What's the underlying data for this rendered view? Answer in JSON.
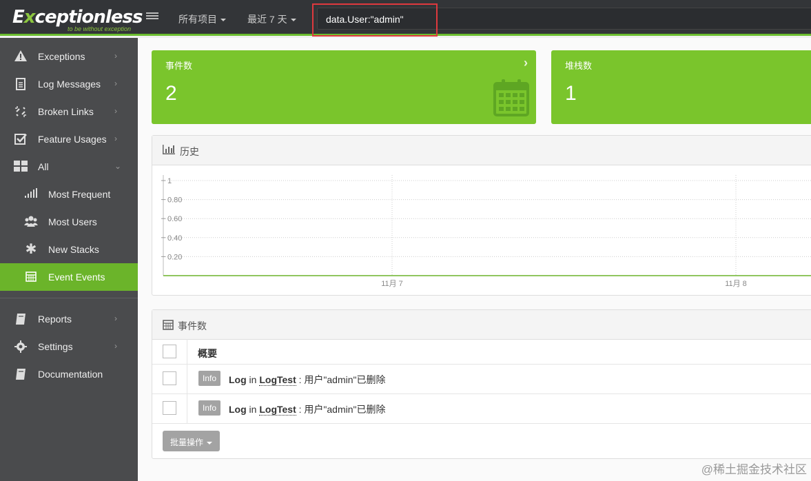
{
  "header": {
    "logo_prefix": "E",
    "logo_x": "x",
    "logo_rest": "ceptionless",
    "logo_tagline": "to be without exception",
    "project_dropdown": "所有项目",
    "time_dropdown": "最近 7 天",
    "search_value": "data.User:\"admin\""
  },
  "sidebar": {
    "items": [
      {
        "label": "Exceptions",
        "icon": "warning-icon"
      },
      {
        "label": "Log Messages",
        "icon": "file-text-icon"
      },
      {
        "label": "Broken Links",
        "icon": "unlink-icon"
      },
      {
        "label": "Feature Usages",
        "icon": "check-square-icon"
      },
      {
        "label": "All",
        "icon": "grid-icon"
      }
    ],
    "sub_items": [
      {
        "label": "Most Frequent",
        "icon": "signal-icon"
      },
      {
        "label": "Most Users",
        "icon": "users-icon"
      },
      {
        "label": "New Stacks",
        "icon": "asterisk-icon"
      },
      {
        "label": "Event Events",
        "icon": "calendar-icon",
        "active": true
      }
    ],
    "bottom_items": [
      {
        "label": "Reports",
        "icon": "book-icon"
      },
      {
        "label": "Settings",
        "icon": "gear-icon"
      },
      {
        "label": "Documentation",
        "icon": "book-icon"
      }
    ]
  },
  "tiles": [
    {
      "title": "事件数",
      "value": "2"
    },
    {
      "title": "堆栈数",
      "value": "1"
    }
  ],
  "history": {
    "title": "历史"
  },
  "chart_data": {
    "type": "line",
    "y_ticks": [
      "1",
      "0.80",
      "0.60",
      "0.40",
      "0.20"
    ],
    "x_ticks": [
      "11月 7",
      "11月 8"
    ],
    "ylim": [
      0,
      1
    ],
    "series": [
      {
        "values": [
          0,
          0,
          0
        ]
      }
    ],
    "grid": true
  },
  "events_panel": {
    "title": "事件数",
    "column_header": "概要",
    "rows": [
      {
        "badge": "Info",
        "type": "Log",
        "in": "in",
        "source": "LogTest",
        "message": ": 用户\"admin\"已删除"
      },
      {
        "badge": "Info",
        "type": "Log",
        "in": "in",
        "source": "LogTest",
        "message": ": 用户\"admin\"已删除"
      }
    ],
    "bulk_action": "批量操作"
  },
  "watermark": "@稀土掘金技术社区",
  "colors": {
    "accent": "#7ac52c",
    "sidebar": "#4a4b4d",
    "topbar": "#333538",
    "highlight": "#e0393e"
  }
}
